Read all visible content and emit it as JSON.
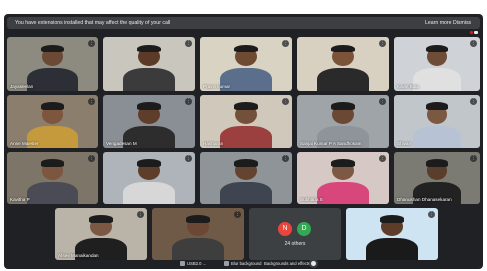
{
  "banner": {
    "message": "You have extensions installed that may affect the quality of your call",
    "learn_more": "Learn more",
    "dismiss": "Dismiss"
  },
  "tiles": [
    {
      "name": "Jayaseelan",
      "bg": "#8d8a80",
      "skin": "#6a4a35",
      "shirt": "#2d2f36"
    },
    {
      "name": "",
      "bg": "#c9c6bd",
      "skin": "#5b3b28",
      "shirt": "#3b3b3b"
    },
    {
      "name": "Pravin kumar",
      "bg": "#d9d3c4",
      "skin": "#6e4a32",
      "shirt": "#5b6f8c"
    },
    {
      "name": "",
      "bg": "#d8d0c1",
      "skin": "#7a5339",
      "shirt": "#2a2a2a"
    },
    {
      "name": "Kavin Bala",
      "bg": "#cfd2d6",
      "skin": "#6e4c37",
      "shirt": "#e0e0e0"
    },
    {
      "name": "Anne Maester",
      "bg": "#8c7e6d",
      "skin": "#7d563d",
      "shirt": "#c49a3c"
    },
    {
      "name": "Vengadesan M",
      "bg": "#8a8f95",
      "skin": "#5e3e2b",
      "shirt": "#2d2d2d"
    },
    {
      "name": "Hariharan",
      "bg": "#cfc8bb",
      "skin": "#73503a",
      "shirt": "#9c3f3f"
    },
    {
      "name": "Sanjai Kumar P A Sandhosam",
      "bg": "#9ea4a8",
      "skin": "#6a4834",
      "shirt": "#8f949a"
    },
    {
      "name": "Shivan",
      "bg": "#c1c6cb",
      "skin": "#7a5842",
      "shirt": "#b7c3d4"
    },
    {
      "name": "Kavitha P",
      "bg": "#7d7668",
      "skin": "#7d563f",
      "shirt": "#4b4b55"
    },
    {
      "name": "",
      "bg": "#aeb4ba",
      "skin": "#5e3e2b",
      "shirt": "#d7d7d7"
    },
    {
      "name": "",
      "bg": "#8f9499",
      "skin": "#644431",
      "shirt": "#3f4550"
    },
    {
      "name": "Subhaba S",
      "bg": "#d6c8c5",
      "skin": "#7d5842",
      "shirt": "#d8477c"
    },
    {
      "name": "Dhanushan Dhanasekaran",
      "bg": "#7b7b73",
      "skin": "#5b3d2b",
      "shirt": "#222222"
    },
    {
      "name": "Afsee Manaikandan",
      "bg": "#b9b3a8",
      "skin": "#7a5843",
      "shirt": "#1f1f1f"
    },
    {
      "name": "",
      "bg": "#6f5a48",
      "skin": "#6a4834",
      "shirt": "#3e3e3e"
    },
    {
      "name": "",
      "bg": "#cfe4f3",
      "skin": "#5d3c2a",
      "shirt": "#1a1a1a"
    }
  ],
  "others": {
    "avatar_left": "N",
    "avatar_left_color": "#e8453c",
    "avatar_right": "D",
    "avatar_right_color": "#34a853",
    "label": "24 others"
  },
  "toolbar": {
    "camera_label": "USB2.0 ...",
    "blur_label": "Blur background",
    "effects_label": "Backgrounds and effects"
  },
  "more_glyph": "⋮"
}
